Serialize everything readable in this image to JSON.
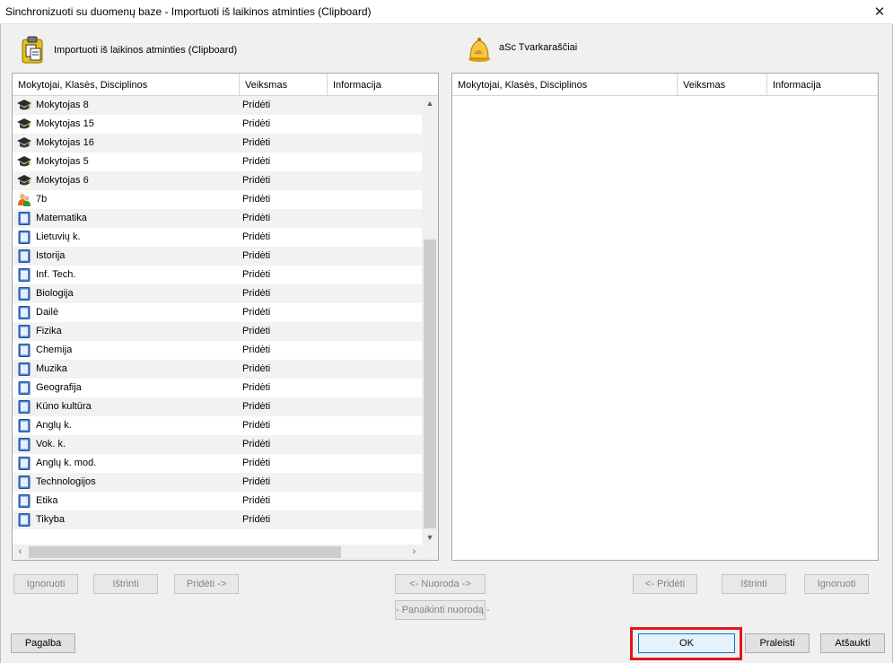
{
  "window": {
    "title": "Sinchronizuoti su duomenų baze - Importuoti iš laikinos atminties (Clipboard)",
    "close_symbol": "✕"
  },
  "source": {
    "label": "Importuoti iš laikinos atminties (Clipboard)"
  },
  "destination": {
    "label": "aSc Tvarkaraščiai"
  },
  "columns": [
    "Mokytojai, Klasės, Disciplinos",
    "Veiksmas",
    "Informacija"
  ],
  "rows": [
    {
      "name": "Mokytojas 8",
      "action": "Pridėti",
      "icon": "teacher-icon"
    },
    {
      "name": "Mokytojas 15",
      "action": "Pridėti",
      "icon": "teacher-icon"
    },
    {
      "name": "Mokytojas 16",
      "action": "Pridėti",
      "icon": "teacher-icon"
    },
    {
      "name": "Mokytojas 5",
      "action": "Pridėti",
      "icon": "teacher-icon"
    },
    {
      "name": "Mokytojas 6",
      "action": "Pridėti",
      "icon": "teacher-icon"
    },
    {
      "name": "7b",
      "action": "Pridėti",
      "icon": "class-icon"
    },
    {
      "name": "Matematika",
      "action": "Pridėti",
      "icon": "subject-icon"
    },
    {
      "name": "Lietuvių k.",
      "action": "Pridėti",
      "icon": "subject-icon"
    },
    {
      "name": "Istorija",
      "action": "Pridėti",
      "icon": "subject-icon"
    },
    {
      "name": "Inf. Tech.",
      "action": "Pridėti",
      "icon": "subject-icon"
    },
    {
      "name": "Biologija",
      "action": "Pridėti",
      "icon": "subject-icon"
    },
    {
      "name": "Dailė",
      "action": "Pridėti",
      "icon": "subject-icon"
    },
    {
      "name": "Fizika",
      "action": "Pridėti",
      "icon": "subject-icon"
    },
    {
      "name": "Chemija",
      "action": "Pridėti",
      "icon": "subject-icon"
    },
    {
      "name": "Muzika",
      "action": "Pridėti",
      "icon": "subject-icon"
    },
    {
      "name": "Geografija",
      "action": "Pridėti",
      "icon": "subject-icon"
    },
    {
      "name": "Kūno kultūra",
      "action": "Pridėti",
      "icon": "subject-icon"
    },
    {
      "name": "Anglų k.",
      "action": "Pridėti",
      "icon": "subject-icon"
    },
    {
      "name": "Vok. k.",
      "action": "Pridėti",
      "icon": "subject-icon"
    },
    {
      "name": "Anglų k. mod.",
      "action": "Pridėti",
      "icon": "subject-icon"
    },
    {
      "name": "Technologijos",
      "action": "Pridėti",
      "icon": "subject-icon"
    },
    {
      "name": "Etika",
      "action": "Pridėti",
      "icon": "subject-icon"
    },
    {
      "name": "Tikyba",
      "action": "Pridėti",
      "icon": "subject-icon"
    }
  ],
  "buttons": {
    "ignore_left": "Ignoruoti",
    "delete_left": "Ištrinti",
    "add_right": "Pridėti ->",
    "link": "<- Nuoroda ->",
    "unlink": "- Panaikinti nuorodą -",
    "add_left": "<- Pridėti",
    "delete_right": "Ištrinti",
    "ignore_right": "Ignoruoti",
    "help": "Pagalba",
    "ok": "OK",
    "skip": "Praleisti",
    "cancel": "Atšaukti"
  },
  "colors": {
    "highlight": "#e0161c",
    "accent": "#0078d7"
  }
}
